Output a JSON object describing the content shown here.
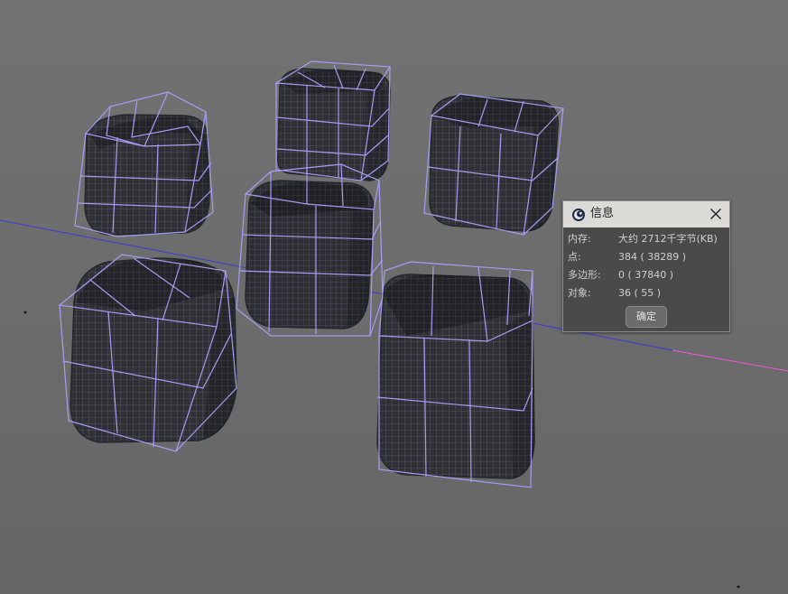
{
  "dialog": {
    "title": "信息",
    "icon": "cinema4d-logo-icon",
    "close_icon": "close-icon",
    "rows": [
      {
        "label": "内存:",
        "value": "大约 2712千字节(KB)"
      },
      {
        "label": "点:",
        "value": "384 ( 38289 )"
      },
      {
        "label": "多边形:",
        "value": "0 ( 37840 )"
      },
      {
        "label": "对象:",
        "value": "36 ( 55 )"
      }
    ],
    "ok_label": "确定"
  },
  "viewport": {
    "background": "#6f6f6f",
    "mesh_color": "#2e3036",
    "cage_color": "#a89cf2",
    "horizon_color": "#3a3adc",
    "x_axis_color": "#e85ad8",
    "objects": [
      "rounded-cube-1",
      "rounded-cube-2",
      "rounded-cube-3",
      "rounded-cube-4",
      "rounded-cube-5",
      "rounded-cube-6"
    ]
  }
}
